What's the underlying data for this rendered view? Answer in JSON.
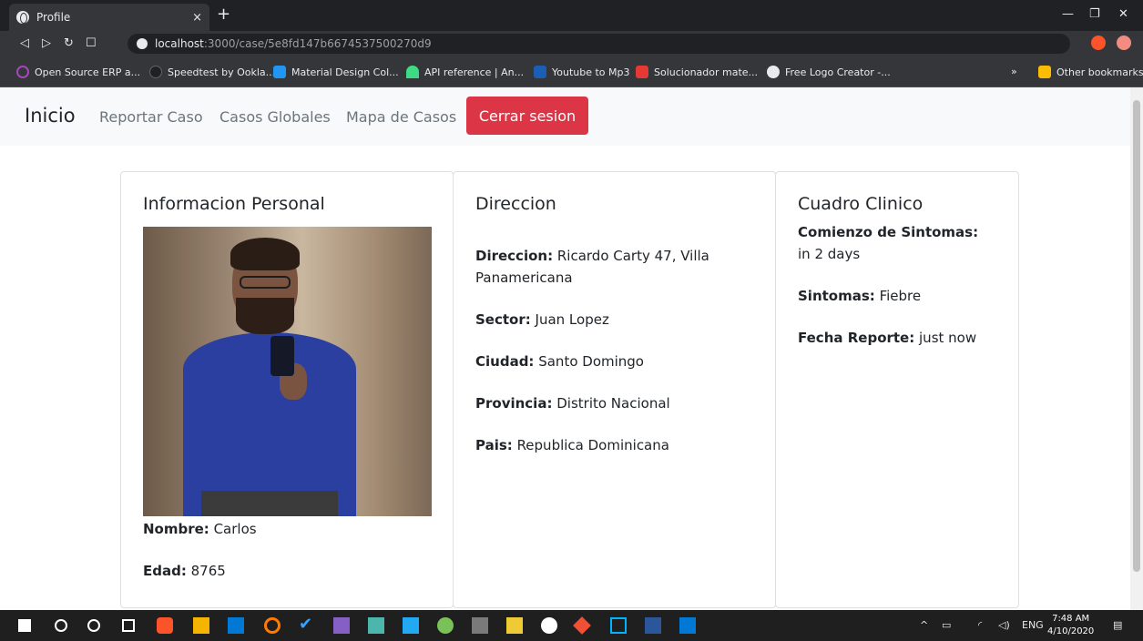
{
  "browser": {
    "tab_title": "Profile",
    "tab_close": "×",
    "new_tab": "+",
    "url_host": "localhost",
    "url_path": ":3000/case/5e8fd147b6674537500270d9",
    "bookmarks": [
      {
        "label": "Open Source ERP a...",
        "color": "#a347ba"
      },
      {
        "label": "Speedtest by Ookla...",
        "color": "#202124"
      },
      {
        "label": "Material Design Col...",
        "color": "#2196f3"
      },
      {
        "label": "API reference | An...",
        "color": "#3ddc84"
      },
      {
        "label": "Youtube to Mp3",
        "color": "#1a5fb4"
      },
      {
        "label": "Solucionador mate...",
        "color": "#e53935"
      },
      {
        "label": "Free Logo Creator -...",
        "color": "#e8eaed"
      }
    ],
    "bookmarks_more": "»",
    "other_bookmarks": "Other bookmarks"
  },
  "nav": {
    "brand": "Inicio",
    "links": [
      "Reportar Caso",
      "Casos Globales",
      "Mapa de Casos"
    ],
    "logout": "Cerrar sesion"
  },
  "personal": {
    "title": "Informacion Personal",
    "name_label": "Nombre:",
    "name_value": "Carlos",
    "age_label": "Edad:",
    "age_value": "8765"
  },
  "address": {
    "title": "Direccion",
    "address_label": "Direccion:",
    "address_value": "Ricardo Carty 47, Villa Panamericana",
    "sector_label": "Sector:",
    "sector_value": "Juan Lopez",
    "city_label": "Ciudad:",
    "city_value": "Santo Domingo",
    "province_label": "Provincia:",
    "province_value": "Distrito Nacional",
    "country_label": "Pais:",
    "country_value": "Republica Dominicana"
  },
  "clinical": {
    "title": "Cuadro Clinico",
    "onset_label": "Comienzo de Sintomas:",
    "onset_value": "in 2 days",
    "symptoms_label": "Sintomas:",
    "symptoms_value": "Fiebre",
    "report_label": "Fecha Reporte:",
    "report_value": "just now"
  },
  "taskbar": {
    "lang": "ENG",
    "time": "7:48 AM",
    "date": "4/10/2020"
  },
  "colors": {
    "danger": "#dc3545",
    "navbar_bg": "#f8f9fa",
    "chrome_dark": "#202124"
  }
}
